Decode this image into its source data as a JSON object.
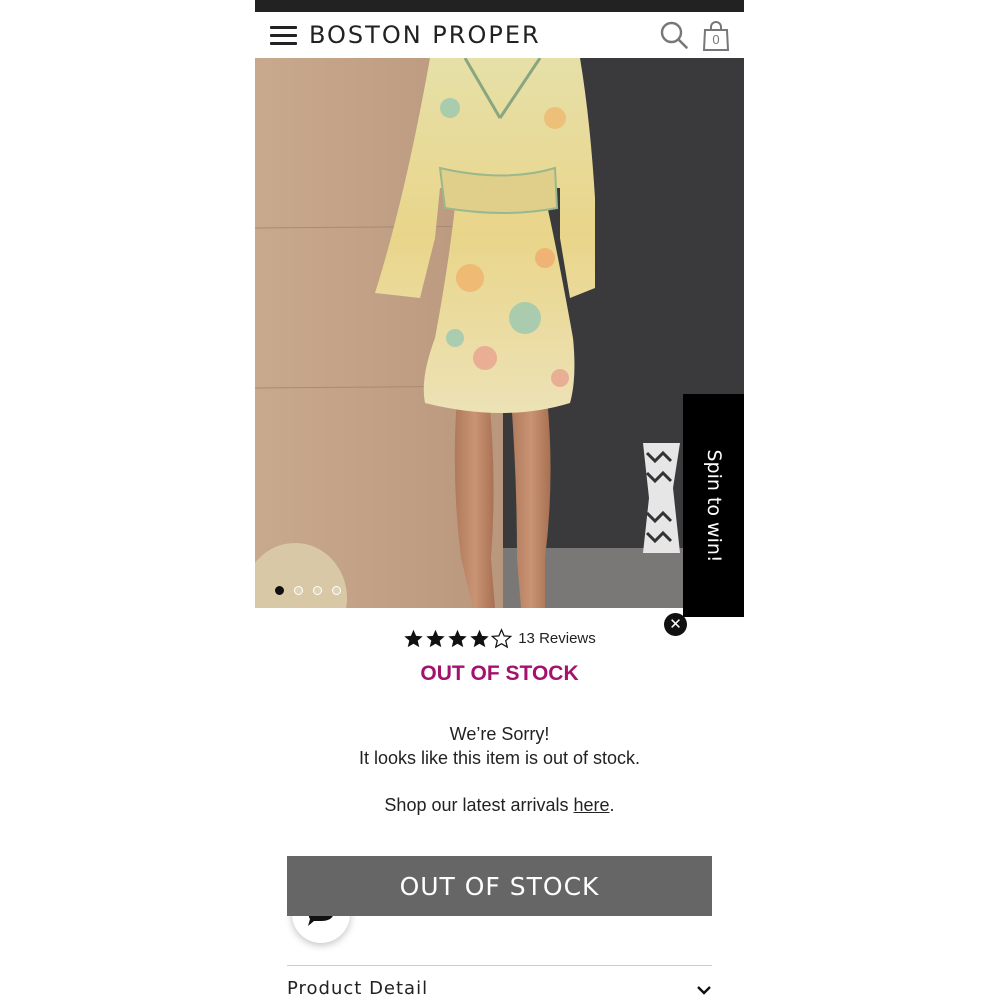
{
  "header": {
    "brand": "BOSTON PROPER",
    "bag_count": "0"
  },
  "carousel": {
    "slide_count": 4,
    "active_slide": 1
  },
  "promo": {
    "spin_label": "Spin to win!"
  },
  "product": {
    "rating": 4,
    "rating_max": 5,
    "reviews_label": "13 Reviews",
    "stock_status": "OUT OF STOCK",
    "sorry_line1": "We’re Sorry!",
    "sorry_line2": "It looks like this item is out of stock.",
    "shop_prefix": "Shop our latest arrivals ",
    "shop_link": "here",
    "shop_suffix": "."
  },
  "actions": {
    "button_label": "OUT OF STOCK"
  },
  "accordion": {
    "product_detail_label": "Product Detail"
  },
  "colors": {
    "accent": "#a3126e",
    "button_bg": "#666666"
  }
}
